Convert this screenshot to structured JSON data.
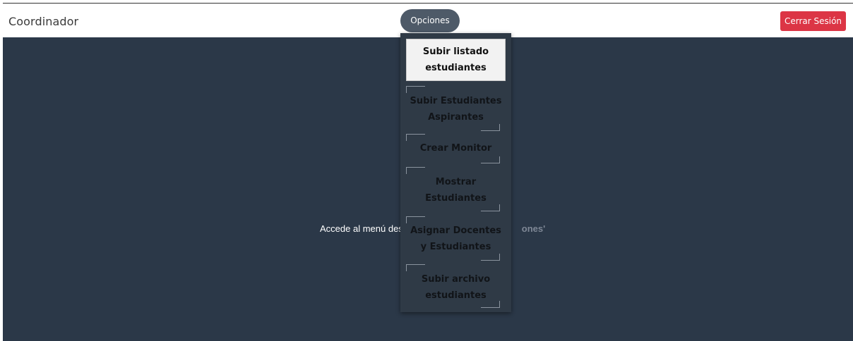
{
  "navbar": {
    "brand": "Coordinador",
    "options_label": "Opciones",
    "logout_label": "Cerrar Sesión"
  },
  "main": {
    "hint_prefix": "Accede al menú des",
    "hint_suffix": "ones'"
  },
  "dropdown": {
    "items": [
      {
        "line1": "Subir listado",
        "line2": "estudiantes"
      },
      {
        "line1": "Subir Estudiantes",
        "line2": "Aspirantes"
      },
      {
        "line1": "Crear Monitor",
        "line2": ""
      },
      {
        "line1": "Mostrar",
        "line2": "Estudiantes"
      },
      {
        "line1": "Asignar Docentes",
        "line2": "y Estudiantes"
      },
      {
        "line1": "Subir archivo",
        "line2": "estudiantes"
      }
    ]
  },
  "colors": {
    "panel": "#2b3848",
    "options_button": "#4e5a68",
    "logout_button": "#dc3545",
    "dropdown": "#2f3a46"
  }
}
